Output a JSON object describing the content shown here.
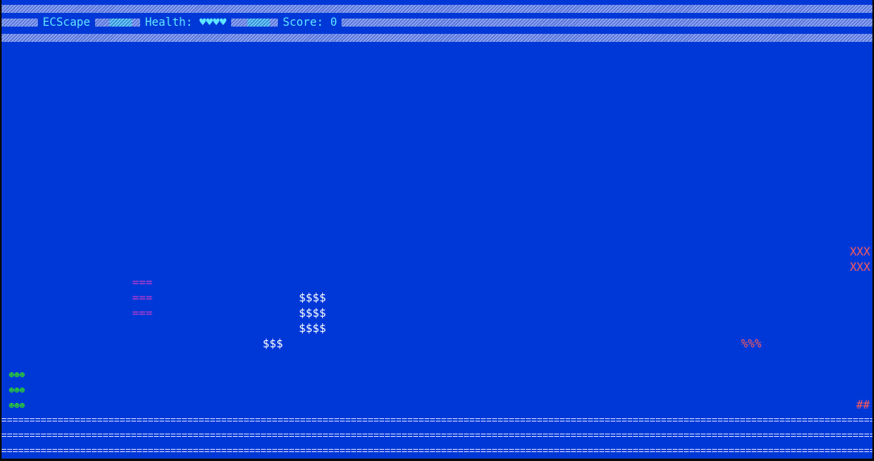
{
  "hud": {
    "title": "ECScape",
    "health_label": "Health:",
    "health_hearts": "♥♥♥♥",
    "score_label": "Score:",
    "score_value": "0"
  },
  "sprites": {
    "enemy_top": [
      "XXX",
      "XXX"
    ],
    "magenta_block": [
      "===",
      "===",
      "==="
    ],
    "coin_stack": [
      "$$$$",
      "$$$$",
      "$$$$"
    ],
    "coin_small": "$$$",
    "hazard": "%%%",
    "player": [
      "☻☻☻",
      "☻☻☻",
      "☻☻☻"
    ],
    "wall_right": "##"
  },
  "colors": {
    "background": "#0038d8",
    "hud_text": "#5fe6ff",
    "enemy": "#ff5a5a",
    "magenta": "#c03cc8",
    "coin": "#ffffff",
    "player": "#2ed12e",
    "floor": "#cfd8ff"
  }
}
